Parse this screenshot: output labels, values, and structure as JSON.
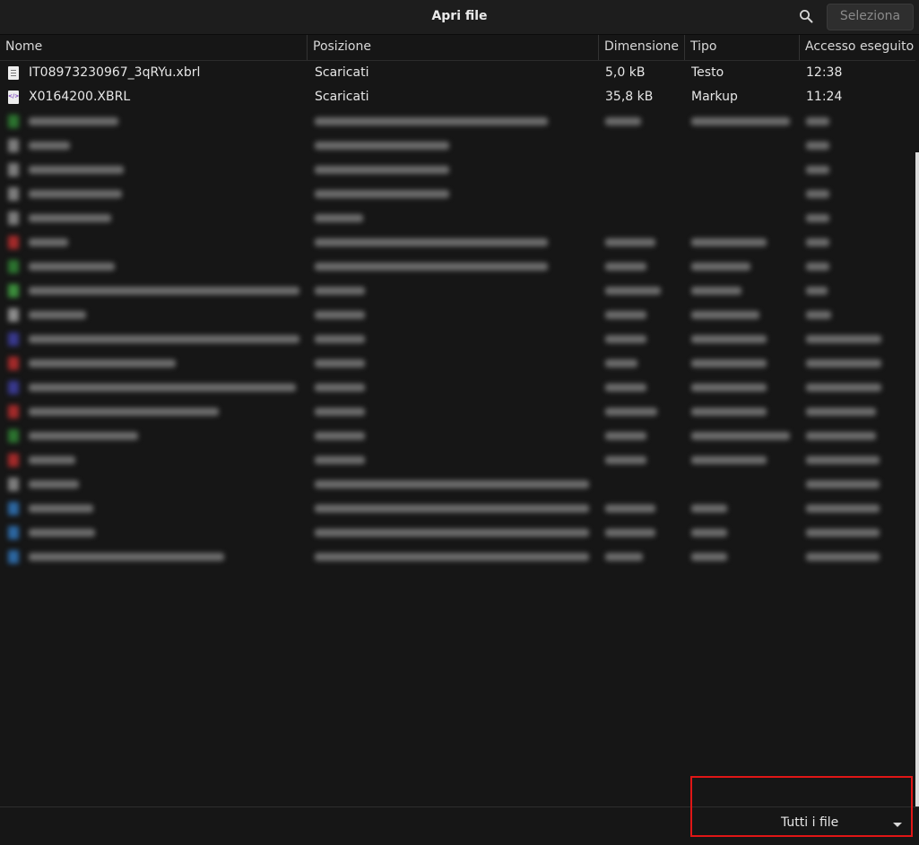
{
  "window": {
    "title": "Apri file"
  },
  "toolbar": {
    "search_icon": "search-icon",
    "select_label": "Seleziona"
  },
  "columns": [
    "Nome",
    "Posizione",
    "Dimensione",
    "Tipo",
    "Accesso eseguito"
  ],
  "files": [
    {
      "icon": "text",
      "name": "IT08973230967_3qRYu.xbrl",
      "location": "Scaricati",
      "size": "5,0 kB",
      "type": "Testo",
      "accessed": "12:38"
    },
    {
      "icon": "markup",
      "name": "X0164200.XBRL",
      "location": "Scaricati",
      "size": "35,8 kB",
      "type": "Markup",
      "accessed": "11:24"
    }
  ],
  "blurred_rows": [
    {
      "color": "#2f7d32"
    },
    {
      "color": "#8a8a8a"
    },
    {
      "color": "#8a8a8a"
    },
    {
      "color": "#8a8a8a"
    },
    {
      "color": "#8a8a8a"
    },
    {
      "color": "#b22c2c"
    },
    {
      "color": "#2f7d32"
    },
    {
      "color": "#3f9a3f"
    },
    {
      "color": "#9a9a9a"
    },
    {
      "color": "#3c3c9a"
    },
    {
      "color": "#b22c2c"
    },
    {
      "color": "#3c3c9a"
    },
    {
      "color": "#b22c2c"
    },
    {
      "color": "#2f7d32"
    },
    {
      "color": "#b22c2c"
    },
    {
      "color": "#8a8a8a"
    },
    {
      "color": "#2f6fb0"
    },
    {
      "color": "#2f6fb0"
    },
    {
      "color": "#2f6fb0"
    }
  ],
  "footer": {
    "filter_label": "Tutti i file",
    "highlight_color": "#e01616"
  }
}
